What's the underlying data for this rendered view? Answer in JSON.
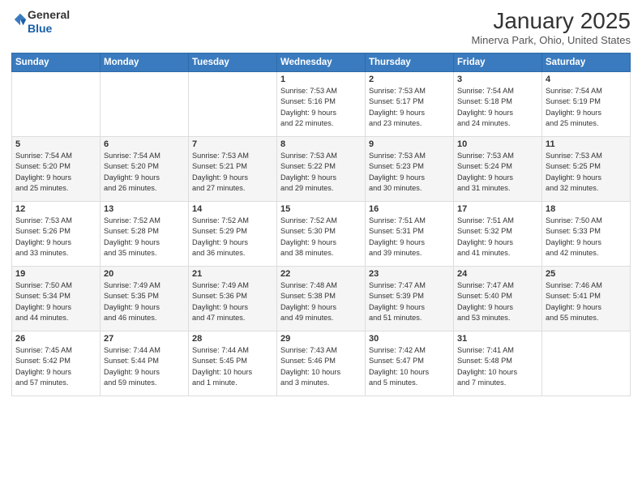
{
  "header": {
    "logo_general": "General",
    "logo_blue": "Blue",
    "month": "January 2025",
    "location": "Minerva Park, Ohio, United States"
  },
  "weekdays": [
    "Sunday",
    "Monday",
    "Tuesday",
    "Wednesday",
    "Thursday",
    "Friday",
    "Saturday"
  ],
  "weeks": [
    [
      {
        "day": "",
        "info": ""
      },
      {
        "day": "",
        "info": ""
      },
      {
        "day": "",
        "info": ""
      },
      {
        "day": "1",
        "info": "Sunrise: 7:53 AM\nSunset: 5:16 PM\nDaylight: 9 hours\nand 22 minutes."
      },
      {
        "day": "2",
        "info": "Sunrise: 7:53 AM\nSunset: 5:17 PM\nDaylight: 9 hours\nand 23 minutes."
      },
      {
        "day": "3",
        "info": "Sunrise: 7:54 AM\nSunset: 5:18 PM\nDaylight: 9 hours\nand 24 minutes."
      },
      {
        "day": "4",
        "info": "Sunrise: 7:54 AM\nSunset: 5:19 PM\nDaylight: 9 hours\nand 25 minutes."
      }
    ],
    [
      {
        "day": "5",
        "info": "Sunrise: 7:54 AM\nSunset: 5:20 PM\nDaylight: 9 hours\nand 25 minutes."
      },
      {
        "day": "6",
        "info": "Sunrise: 7:54 AM\nSunset: 5:20 PM\nDaylight: 9 hours\nand 26 minutes."
      },
      {
        "day": "7",
        "info": "Sunrise: 7:53 AM\nSunset: 5:21 PM\nDaylight: 9 hours\nand 27 minutes."
      },
      {
        "day": "8",
        "info": "Sunrise: 7:53 AM\nSunset: 5:22 PM\nDaylight: 9 hours\nand 29 minutes."
      },
      {
        "day": "9",
        "info": "Sunrise: 7:53 AM\nSunset: 5:23 PM\nDaylight: 9 hours\nand 30 minutes."
      },
      {
        "day": "10",
        "info": "Sunrise: 7:53 AM\nSunset: 5:24 PM\nDaylight: 9 hours\nand 31 minutes."
      },
      {
        "day": "11",
        "info": "Sunrise: 7:53 AM\nSunset: 5:25 PM\nDaylight: 9 hours\nand 32 minutes."
      }
    ],
    [
      {
        "day": "12",
        "info": "Sunrise: 7:53 AM\nSunset: 5:26 PM\nDaylight: 9 hours\nand 33 minutes."
      },
      {
        "day": "13",
        "info": "Sunrise: 7:52 AM\nSunset: 5:28 PM\nDaylight: 9 hours\nand 35 minutes."
      },
      {
        "day": "14",
        "info": "Sunrise: 7:52 AM\nSunset: 5:29 PM\nDaylight: 9 hours\nand 36 minutes."
      },
      {
        "day": "15",
        "info": "Sunrise: 7:52 AM\nSunset: 5:30 PM\nDaylight: 9 hours\nand 38 minutes."
      },
      {
        "day": "16",
        "info": "Sunrise: 7:51 AM\nSunset: 5:31 PM\nDaylight: 9 hours\nand 39 minutes."
      },
      {
        "day": "17",
        "info": "Sunrise: 7:51 AM\nSunset: 5:32 PM\nDaylight: 9 hours\nand 41 minutes."
      },
      {
        "day": "18",
        "info": "Sunrise: 7:50 AM\nSunset: 5:33 PM\nDaylight: 9 hours\nand 42 minutes."
      }
    ],
    [
      {
        "day": "19",
        "info": "Sunrise: 7:50 AM\nSunset: 5:34 PM\nDaylight: 9 hours\nand 44 minutes."
      },
      {
        "day": "20",
        "info": "Sunrise: 7:49 AM\nSunset: 5:35 PM\nDaylight: 9 hours\nand 46 minutes."
      },
      {
        "day": "21",
        "info": "Sunrise: 7:49 AM\nSunset: 5:36 PM\nDaylight: 9 hours\nand 47 minutes."
      },
      {
        "day": "22",
        "info": "Sunrise: 7:48 AM\nSunset: 5:38 PM\nDaylight: 9 hours\nand 49 minutes."
      },
      {
        "day": "23",
        "info": "Sunrise: 7:47 AM\nSunset: 5:39 PM\nDaylight: 9 hours\nand 51 minutes."
      },
      {
        "day": "24",
        "info": "Sunrise: 7:47 AM\nSunset: 5:40 PM\nDaylight: 9 hours\nand 53 minutes."
      },
      {
        "day": "25",
        "info": "Sunrise: 7:46 AM\nSunset: 5:41 PM\nDaylight: 9 hours\nand 55 minutes."
      }
    ],
    [
      {
        "day": "26",
        "info": "Sunrise: 7:45 AM\nSunset: 5:42 PM\nDaylight: 9 hours\nand 57 minutes."
      },
      {
        "day": "27",
        "info": "Sunrise: 7:44 AM\nSunset: 5:44 PM\nDaylight: 9 hours\nand 59 minutes."
      },
      {
        "day": "28",
        "info": "Sunrise: 7:44 AM\nSunset: 5:45 PM\nDaylight: 10 hours\nand 1 minute."
      },
      {
        "day": "29",
        "info": "Sunrise: 7:43 AM\nSunset: 5:46 PM\nDaylight: 10 hours\nand 3 minutes."
      },
      {
        "day": "30",
        "info": "Sunrise: 7:42 AM\nSunset: 5:47 PM\nDaylight: 10 hours\nand 5 minutes."
      },
      {
        "day": "31",
        "info": "Sunrise: 7:41 AM\nSunset: 5:48 PM\nDaylight: 10 hours\nand 7 minutes."
      },
      {
        "day": "",
        "info": ""
      }
    ]
  ]
}
